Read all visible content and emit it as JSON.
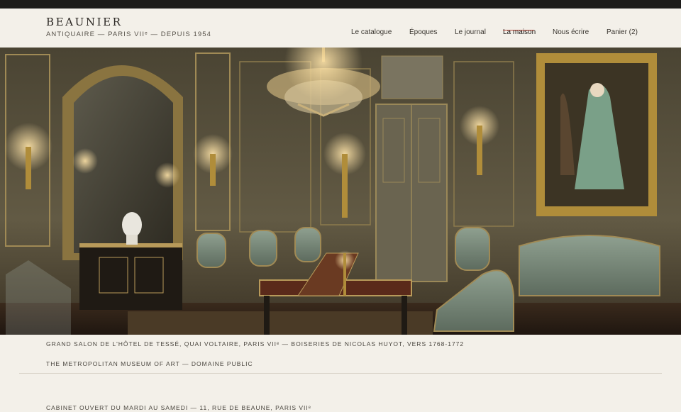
{
  "header": {
    "brand": "BEAUNIER",
    "tagline": "ANTIQUAIRE — PARIS VIIᵉ — DEPUIS 1954"
  },
  "nav": {
    "items": [
      {
        "label": "Le catalogue",
        "active": false
      },
      {
        "label": "Époques",
        "active": false
      },
      {
        "label": "Le journal",
        "active": false
      },
      {
        "label": "La maison",
        "active": true
      },
      {
        "label": "Nous écrire",
        "active": false
      },
      {
        "label": "Panier (2)",
        "active": false
      }
    ],
    "accent_color": "#b04a3c"
  },
  "hero": {
    "image_subject": "grand-salon-interior"
  },
  "captions": {
    "line1": "GRAND SALON DE L'HÔTEL DE TESSÉ, QUAI VOLTAIRE, PARIS VIIᵉ — BOISERIES DE NICOLAS HUYOT, VERS 1768-1772",
    "line2": "THE METROPOLITAN MUSEUM OF ART — DOMAINE PUBLIC"
  },
  "footer": {
    "hours": "CABINET OUVERT DU MARDI AU SAMEDI — 11, RUE DE BEAUNE, PARIS VIIᵉ"
  }
}
